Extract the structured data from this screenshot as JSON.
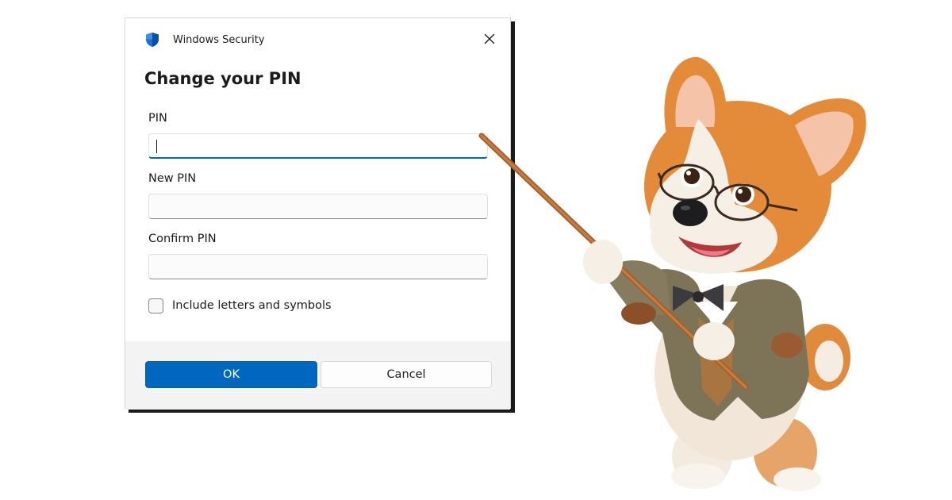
{
  "dialog": {
    "app_title": "Windows Security",
    "heading": "Change your PIN",
    "fields": [
      {
        "label": "PIN",
        "value": "",
        "focused": true
      },
      {
        "label": "New PIN",
        "value": "",
        "focused": false
      },
      {
        "label": "Confirm PIN",
        "value": "",
        "focused": false
      }
    ],
    "checkbox": {
      "label": "Include letters and symbols",
      "checked": false
    },
    "buttons": {
      "ok": "OK",
      "cancel": "Cancel"
    },
    "icons": {
      "app": "shield-icon",
      "close": "close-icon"
    }
  },
  "colors": {
    "accent": "#0067c0",
    "footer_bg": "#f3f3f3",
    "corgi_orange": "#e08a3c",
    "jacket": "#7d7458"
  },
  "illustration": {
    "subject": "cartoon corgi with glasses and bow tie holding a pointer stick"
  }
}
